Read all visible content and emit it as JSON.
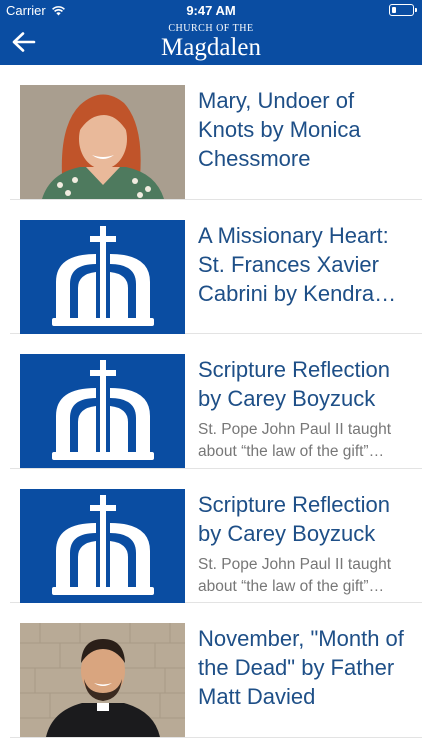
{
  "status_bar": {
    "carrier": "Carrier",
    "time": "9:47 AM"
  },
  "nav": {
    "brand_small": "CHURCH OF THE",
    "brand_big": "Magdalen",
    "back_icon": "arrow-left-icon"
  },
  "colors": {
    "brand_blue": "#0a4da2",
    "title_blue": "#1e4f87"
  },
  "articles": [
    {
      "title": "Mary, Undoer of Knots by Monica Chessmore",
      "excerpt": "",
      "thumbnail": "photo-woman"
    },
    {
      "title": "A Missionary Heart: St. Frances Xavier Cabrini by Kendra…",
      "excerpt": "",
      "thumbnail": "church-logo"
    },
    {
      "title": "Scripture Reflection by Carey Boyzuck",
      "excerpt": "St. Pope John Paul II taught about “the law of the gift”…",
      "thumbnail": "church-logo"
    },
    {
      "title": "Scripture Reflection by Carey Boyzuck",
      "excerpt": "St. Pope John Paul II taught about “the law of the gift”…",
      "thumbnail": "church-logo"
    },
    {
      "title": "November, \"Month of the Dead\" by Father Matt Davied",
      "excerpt": "",
      "thumbnail": "photo-priest"
    }
  ]
}
